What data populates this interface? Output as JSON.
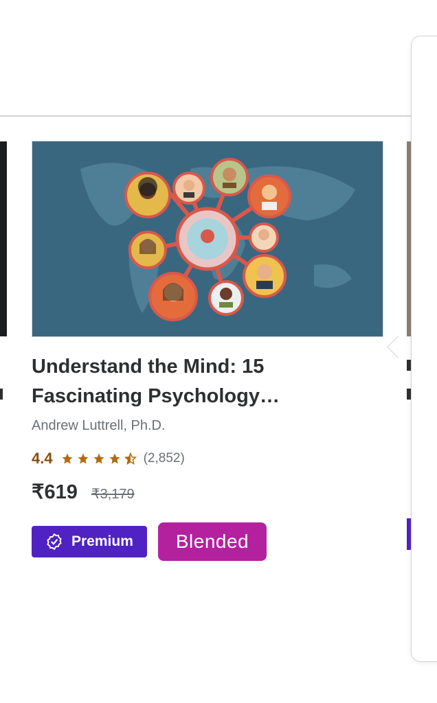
{
  "course": {
    "title": "Understand the Mind: 15 Fascinating Psychology…",
    "instructor": "Andrew Luttrell, Ph.D.",
    "rating": "4.4",
    "rating_value": 4.4,
    "reviews": "(2,852)",
    "price": "₹619",
    "original_price": "₹3,179",
    "badge_premium": "Premium",
    "badge_blended": "Blended"
  },
  "colors": {
    "premium_bg": "#5022c3",
    "blended_bg": "#b4219e",
    "rating_color": "#8a4d0f",
    "thumb_bg": "#3f6f88"
  },
  "icons": {
    "star": "star-icon",
    "half_star": "half-star-icon",
    "premium": "verified-badge-icon"
  }
}
